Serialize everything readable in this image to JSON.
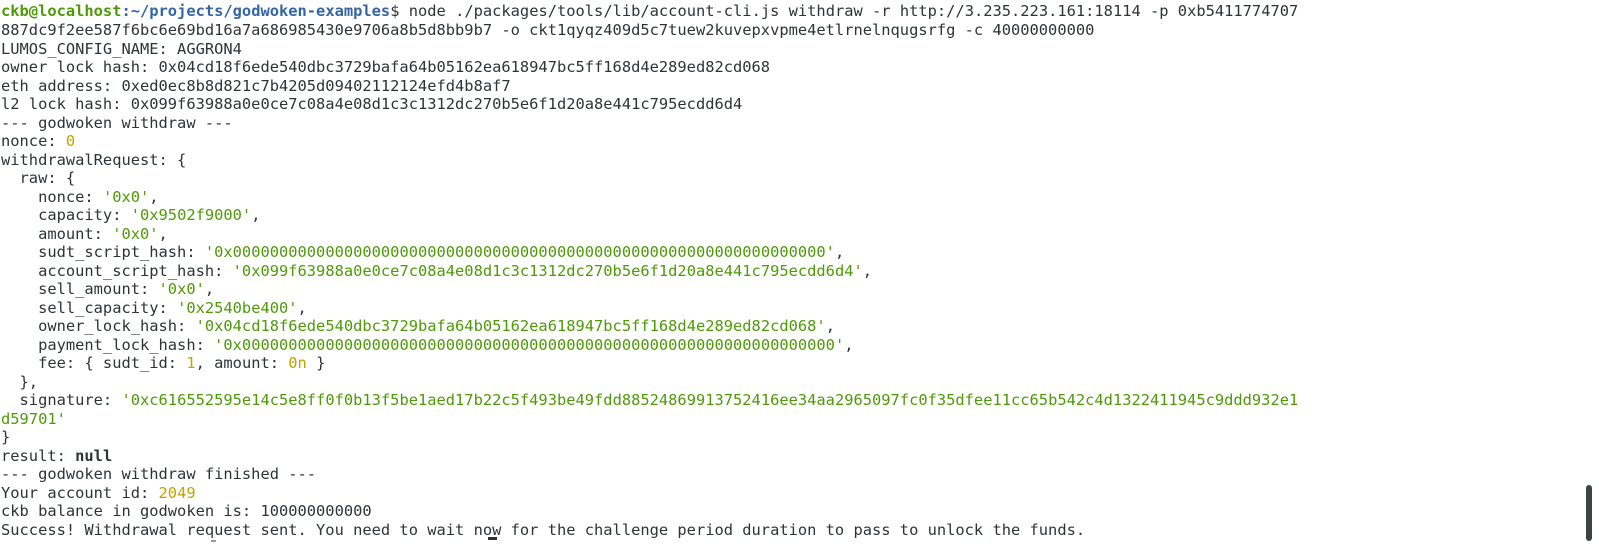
{
  "prompt": {
    "user_host": "ckb@localhost",
    "path": ":~/projects/godwoken-examples",
    "symbol": "$ ",
    "command": "node ./packages/tools/lib/account-cli.js withdraw -r http://3.235.223.161:18114 -p 0xb5411774707",
    "command_cont": "887dc9f2ee587f6bc6e69bd16a7a686985430e9706a8b5d8bb9b7 -o ckt1qyqz409d5c7tuew2kuvepxvpme4etlrnelnqugsrfg -c 40000000000"
  },
  "output": {
    "lumos_config": "LUMOS_CONFIG_NAME: AGGRON4",
    "owner_lock_hash": "owner lock hash: 0x04cd18f6ede540dbc3729bafa64b05162ea618947bc5ff168d4e289ed82cd068",
    "eth_address": "eth address: 0xed0ec8b8d821c7b4205d09402112124efd4b8af7",
    "l2_lock_hash": "l2 lock hash: 0x099f63988a0e0ce7c08a4e08d1c3c1312dc270b5e6f1d20a8e441c795ecdd6d4",
    "withdraw_header": "--- godwoken withdraw ---",
    "nonce_label": "nonce: ",
    "nonce_value": "0",
    "request_open": "withdrawalRequest: {",
    "raw_open": "  raw: {",
    "raw_fields": [
      {
        "key": "    nonce: ",
        "value": "'0x0'",
        "end": ","
      },
      {
        "key": "    capacity: ",
        "value": "'0x9502f9000'",
        "end": ","
      },
      {
        "key": "    amount: ",
        "value": "'0x0'",
        "end": ","
      },
      {
        "key": "    sudt_script_hash: ",
        "value": "'0x0000000000000000000000000000000000000000000000000000000000000000'",
        "end": ","
      },
      {
        "key": "    account_script_hash: ",
        "value": "'0x099f63988a0e0ce7c08a4e08d1c3c1312dc270b5e6f1d20a8e441c795ecdd6d4'",
        "end": ","
      },
      {
        "key": "    sell_amount: ",
        "value": "'0x0'",
        "end": ","
      },
      {
        "key": "    sell_capacity: ",
        "value": "'0x2540be400'",
        "end": ","
      },
      {
        "key": "    owner_lock_hash: ",
        "value": "'0x04cd18f6ede540dbc3729bafa64b05162ea618947bc5ff168d4e289ed82cd068'",
        "end": ","
      },
      {
        "key": "    payment_lock_hash: ",
        "value": "'0x0000000000000000000000000000000000000000000000000000000000000000'",
        "end": ","
      }
    ],
    "fee_prefix": "    fee: { sudt_id: ",
    "fee_sudt_id": "1",
    "fee_mid": ", amount: ",
    "fee_amount": "0n",
    "fee_suffix": " }",
    "raw_close": "  },",
    "signature_label": "  signature: ",
    "signature_part1": "'0xc616552595e14c5e8ff0f0b13f5be1aed17b22c5f493be49fdd88524869913752416ee34aa2965097fc0f35dfee11cc65b542c4d1322411945c9ddd932e1",
    "signature_part2": "d59701'",
    "request_close": "}",
    "result_label": "result: ",
    "result_value": "null",
    "finished": "--- godwoken withdraw finished ---",
    "account_id_label": "Your account id: ",
    "account_id_value": "2049",
    "balance": "ckb balance in godwoken is: 100000000000",
    "success": "Success! Withdrawal request sent. You need to wait now for the challenge period duration to pass to unlock the funds."
  }
}
